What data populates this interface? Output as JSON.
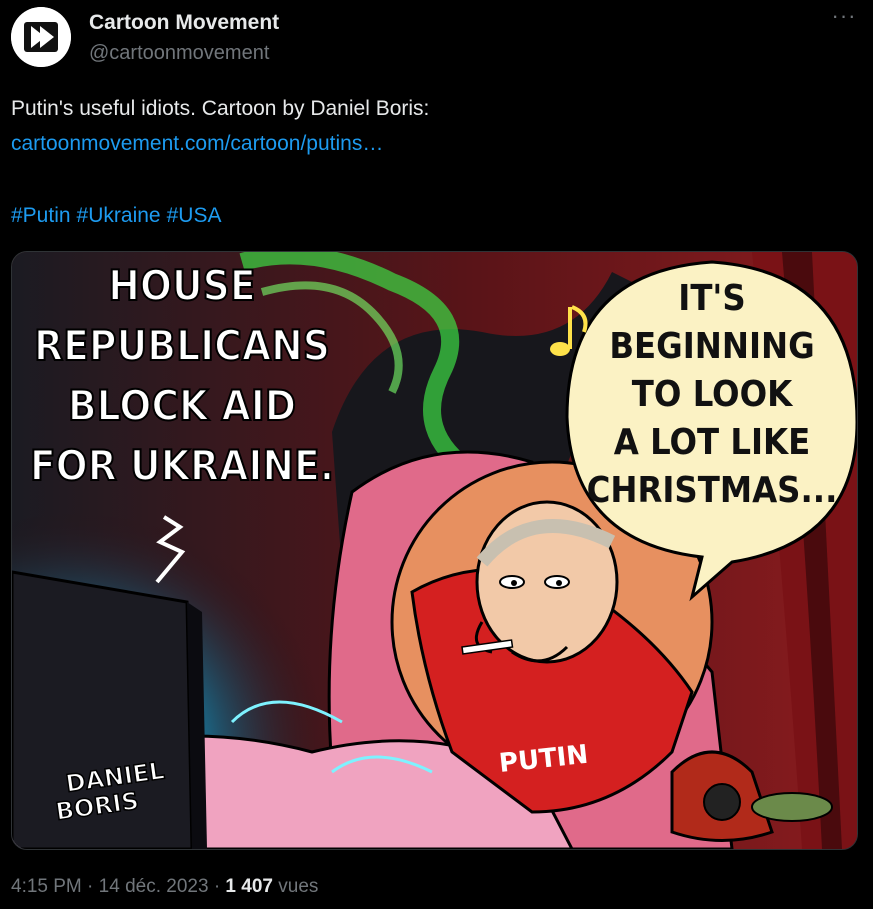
{
  "account": {
    "display_name": "Cartoon Movement",
    "handle": "@cartoonmovement",
    "avatar_icon": "cartoon-movement-logo-icon"
  },
  "menu": {
    "more_label": "···"
  },
  "tweet": {
    "line1": "Putin's useful idiots. Cartoon by Daniel Boris:",
    "link": "cartoonmovement.com/cartoon/putins…",
    "hashtags": [
      "#Putin",
      "#Ukraine",
      "#USA"
    ]
  },
  "cartoon": {
    "caption_lines": [
      "HOUSE",
      "REPUBLICANS",
      "BLOCK AID",
      "FOR UKRAINE."
    ],
    "bubble_lines": [
      "IT'S",
      "BEGINNING",
      "TO LOOK",
      "A LOT LIKE",
      "CHRISTMAS..."
    ],
    "shirt_label": "PUTIN",
    "signature_lines": [
      "DANIEL",
      "BORIS"
    ],
    "colors": {
      "background": "#3a1014",
      "bubble": "#fbf2c4",
      "shirt": "#d42020",
      "bed": "#e06a8a",
      "smoke": "#3ddc44"
    }
  },
  "footer": {
    "time": "4:15 PM",
    "date": "14 déc. 2023",
    "views_count": "1 407",
    "views_label": "vues"
  }
}
